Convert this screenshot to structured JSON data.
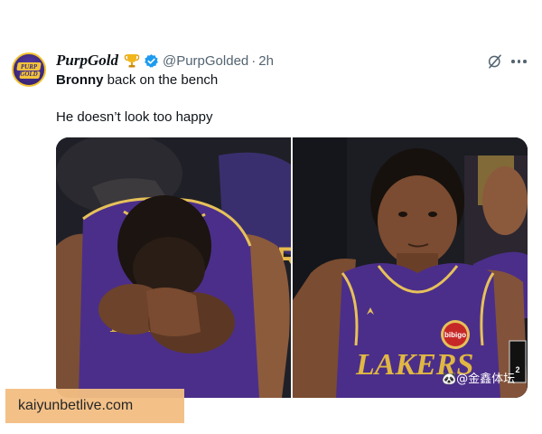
{
  "post": {
    "display_name": "PurpGold",
    "handle": "@PurpGolded",
    "separator": "·",
    "time": "2h",
    "avatar_text": "PURP GOLD",
    "line1_bold": "Bronny",
    "line1_rest": " back on the bench",
    "line2": "He doesn’t look too happy"
  },
  "media": {
    "jersey_wordmark": "LAKERS",
    "sponsor_patch": "bibigo",
    "partial_text": "PR",
    "scorebug": "2"
  },
  "watermarks": {
    "channel": "🐼@金鑫体坛",
    "site": "kaiyunbetlive.com"
  },
  "colors": {
    "lakers_purple": "#4b2e8a",
    "lakers_gold": "#f2c230",
    "verified_blue": "#1d9bf0",
    "watermark_bg": "#f3be82"
  },
  "icons": [
    "trophy-icon",
    "verified-badge-icon",
    "grok-icon",
    "more-icon"
  ]
}
